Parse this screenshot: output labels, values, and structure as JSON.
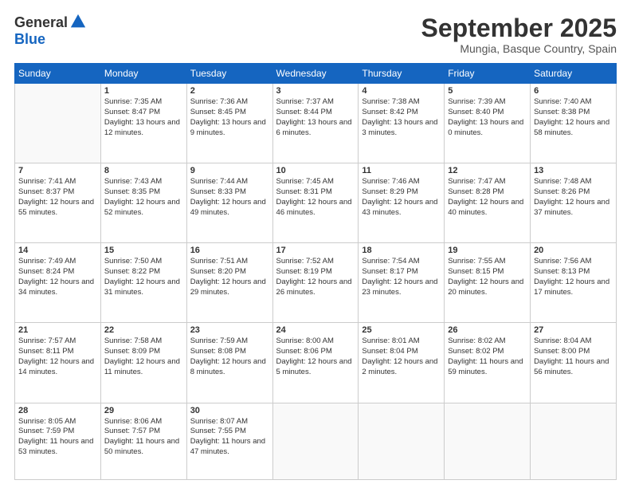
{
  "logo": {
    "general": "General",
    "blue": "Blue"
  },
  "title": "September 2025",
  "subtitle": "Mungia, Basque Country, Spain",
  "weekdays": [
    "Sunday",
    "Monday",
    "Tuesday",
    "Wednesday",
    "Thursday",
    "Friday",
    "Saturday"
  ],
  "weeks": [
    [
      {
        "day": "",
        "sunrise": "",
        "sunset": "",
        "daylight": ""
      },
      {
        "day": "1",
        "sunrise": "Sunrise: 7:35 AM",
        "sunset": "Sunset: 8:47 PM",
        "daylight": "Daylight: 13 hours and 12 minutes."
      },
      {
        "day": "2",
        "sunrise": "Sunrise: 7:36 AM",
        "sunset": "Sunset: 8:45 PM",
        "daylight": "Daylight: 13 hours and 9 minutes."
      },
      {
        "day": "3",
        "sunrise": "Sunrise: 7:37 AM",
        "sunset": "Sunset: 8:44 PM",
        "daylight": "Daylight: 13 hours and 6 minutes."
      },
      {
        "day": "4",
        "sunrise": "Sunrise: 7:38 AM",
        "sunset": "Sunset: 8:42 PM",
        "daylight": "Daylight: 13 hours and 3 minutes."
      },
      {
        "day": "5",
        "sunrise": "Sunrise: 7:39 AM",
        "sunset": "Sunset: 8:40 PM",
        "daylight": "Daylight: 13 hours and 0 minutes."
      },
      {
        "day": "6",
        "sunrise": "Sunrise: 7:40 AM",
        "sunset": "Sunset: 8:38 PM",
        "daylight": "Daylight: 12 hours and 58 minutes."
      }
    ],
    [
      {
        "day": "7",
        "sunrise": "Sunrise: 7:41 AM",
        "sunset": "Sunset: 8:37 PM",
        "daylight": "Daylight: 12 hours and 55 minutes."
      },
      {
        "day": "8",
        "sunrise": "Sunrise: 7:43 AM",
        "sunset": "Sunset: 8:35 PM",
        "daylight": "Daylight: 12 hours and 52 minutes."
      },
      {
        "day": "9",
        "sunrise": "Sunrise: 7:44 AM",
        "sunset": "Sunset: 8:33 PM",
        "daylight": "Daylight: 12 hours and 49 minutes."
      },
      {
        "day": "10",
        "sunrise": "Sunrise: 7:45 AM",
        "sunset": "Sunset: 8:31 PM",
        "daylight": "Daylight: 12 hours and 46 minutes."
      },
      {
        "day": "11",
        "sunrise": "Sunrise: 7:46 AM",
        "sunset": "Sunset: 8:29 PM",
        "daylight": "Daylight: 12 hours and 43 minutes."
      },
      {
        "day": "12",
        "sunrise": "Sunrise: 7:47 AM",
        "sunset": "Sunset: 8:28 PM",
        "daylight": "Daylight: 12 hours and 40 minutes."
      },
      {
        "day": "13",
        "sunrise": "Sunrise: 7:48 AM",
        "sunset": "Sunset: 8:26 PM",
        "daylight": "Daylight: 12 hours and 37 minutes."
      }
    ],
    [
      {
        "day": "14",
        "sunrise": "Sunrise: 7:49 AM",
        "sunset": "Sunset: 8:24 PM",
        "daylight": "Daylight: 12 hours and 34 minutes."
      },
      {
        "day": "15",
        "sunrise": "Sunrise: 7:50 AM",
        "sunset": "Sunset: 8:22 PM",
        "daylight": "Daylight: 12 hours and 31 minutes."
      },
      {
        "day": "16",
        "sunrise": "Sunrise: 7:51 AM",
        "sunset": "Sunset: 8:20 PM",
        "daylight": "Daylight: 12 hours and 29 minutes."
      },
      {
        "day": "17",
        "sunrise": "Sunrise: 7:52 AM",
        "sunset": "Sunset: 8:19 PM",
        "daylight": "Daylight: 12 hours and 26 minutes."
      },
      {
        "day": "18",
        "sunrise": "Sunrise: 7:54 AM",
        "sunset": "Sunset: 8:17 PM",
        "daylight": "Daylight: 12 hours and 23 minutes."
      },
      {
        "day": "19",
        "sunrise": "Sunrise: 7:55 AM",
        "sunset": "Sunset: 8:15 PM",
        "daylight": "Daylight: 12 hours and 20 minutes."
      },
      {
        "day": "20",
        "sunrise": "Sunrise: 7:56 AM",
        "sunset": "Sunset: 8:13 PM",
        "daylight": "Daylight: 12 hours and 17 minutes."
      }
    ],
    [
      {
        "day": "21",
        "sunrise": "Sunrise: 7:57 AM",
        "sunset": "Sunset: 8:11 PM",
        "daylight": "Daylight: 12 hours and 14 minutes."
      },
      {
        "day": "22",
        "sunrise": "Sunrise: 7:58 AM",
        "sunset": "Sunset: 8:09 PM",
        "daylight": "Daylight: 12 hours and 11 minutes."
      },
      {
        "day": "23",
        "sunrise": "Sunrise: 7:59 AM",
        "sunset": "Sunset: 8:08 PM",
        "daylight": "Daylight: 12 hours and 8 minutes."
      },
      {
        "day": "24",
        "sunrise": "Sunrise: 8:00 AM",
        "sunset": "Sunset: 8:06 PM",
        "daylight": "Daylight: 12 hours and 5 minutes."
      },
      {
        "day": "25",
        "sunrise": "Sunrise: 8:01 AM",
        "sunset": "Sunset: 8:04 PM",
        "daylight": "Daylight: 12 hours and 2 minutes."
      },
      {
        "day": "26",
        "sunrise": "Sunrise: 8:02 AM",
        "sunset": "Sunset: 8:02 PM",
        "daylight": "Daylight: 11 hours and 59 minutes."
      },
      {
        "day": "27",
        "sunrise": "Sunrise: 8:04 AM",
        "sunset": "Sunset: 8:00 PM",
        "daylight": "Daylight: 11 hours and 56 minutes."
      }
    ],
    [
      {
        "day": "28",
        "sunrise": "Sunrise: 8:05 AM",
        "sunset": "Sunset: 7:59 PM",
        "daylight": "Daylight: 11 hours and 53 minutes."
      },
      {
        "day": "29",
        "sunrise": "Sunrise: 8:06 AM",
        "sunset": "Sunset: 7:57 PM",
        "daylight": "Daylight: 11 hours and 50 minutes."
      },
      {
        "day": "30",
        "sunrise": "Sunrise: 8:07 AM",
        "sunset": "Sunset: 7:55 PM",
        "daylight": "Daylight: 11 hours and 47 minutes."
      },
      {
        "day": "",
        "sunrise": "",
        "sunset": "",
        "daylight": ""
      },
      {
        "day": "",
        "sunrise": "",
        "sunset": "",
        "daylight": ""
      },
      {
        "day": "",
        "sunrise": "",
        "sunset": "",
        "daylight": ""
      },
      {
        "day": "",
        "sunrise": "",
        "sunset": "",
        "daylight": ""
      }
    ]
  ]
}
